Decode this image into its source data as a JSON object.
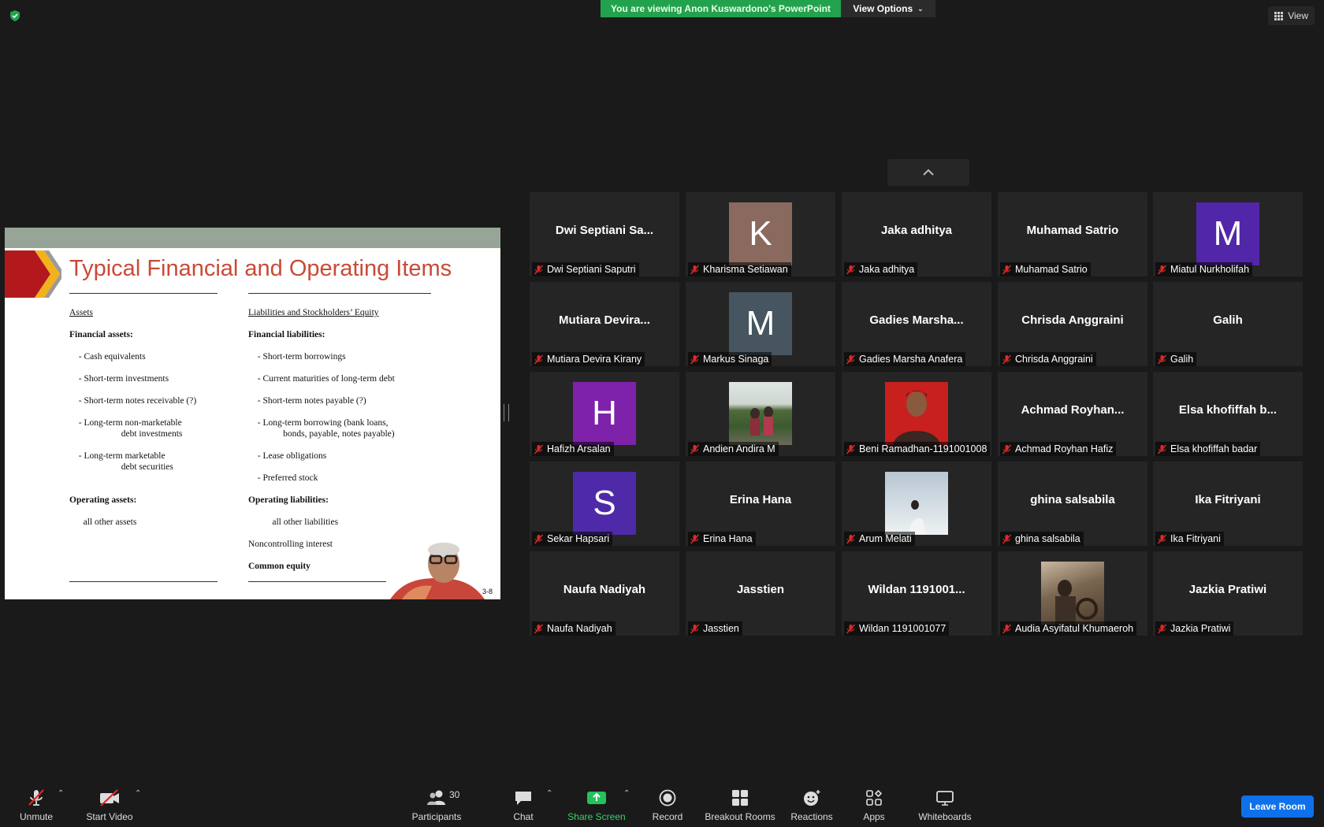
{
  "header": {
    "viewing_text": "You are viewing Anon Kuswardono's PowerPoint",
    "view_options_label": "View Options",
    "view_label": "View"
  },
  "slide": {
    "title": "Typical Financial and Operating Items",
    "page_number": "3-8",
    "left_column": [
      {
        "text": "Assets",
        "style": "u"
      },
      {
        "text": "Financial assets:",
        "style": "b"
      },
      {
        "text": "  - Cash equivalents",
        "style": ""
      },
      {
        "text": "  - Short-term investments",
        "style": ""
      },
      {
        "text": "  - Short-term notes receivable (?)",
        "style": ""
      },
      {
        "text": "  - Long-term non-marketable",
        "style": ""
      },
      {
        "text": "          debt investments",
        "style": ""
      },
      {
        "text": "  - Long-term marketable",
        "style": ""
      },
      {
        "text": "          debt securities",
        "style": ""
      },
      {
        "text": "Operating assets:",
        "style": "b"
      },
      {
        "text": "   all other assets",
        "style": ""
      }
    ],
    "right_column": [
      {
        "text": "Liabilities and Stockholders’ Equity",
        "style": "u"
      },
      {
        "text": "Financial liabilities:",
        "style": "b"
      },
      {
        "text": "  - Short-term borrowings",
        "style": ""
      },
      {
        "text": "  - Current maturities of long-term debt",
        "style": ""
      },
      {
        "text": "  - Short-term notes payable (?)",
        "style": ""
      },
      {
        "text": "  - Long-term borrowing (bank loans,",
        "style": ""
      },
      {
        "text": "       bonds, payable, notes payable)",
        "style": ""
      },
      {
        "text": "  - Lease obligations",
        "style": ""
      },
      {
        "text": "  - Preferred stock",
        "style": ""
      },
      {
        "text": "Operating liabilities:",
        "style": "b"
      },
      {
        "text": "     all other liabilities",
        "style": ""
      },
      {
        "text": "Noncontrolling interest",
        "style": ""
      },
      {
        "text": "Common equity",
        "style": "b"
      }
    ]
  },
  "participants": [
    {
      "display": "Dwi  Septiani  Sa...",
      "name": "Dwi Septiani Saputri",
      "avatar": null
    },
    {
      "display": "",
      "name": "Kharisma Setiawan",
      "avatar": {
        "letter": "K",
        "color": "#8a6a5e"
      }
    },
    {
      "display": "Jaka adhitya",
      "name": "Jaka adhitya",
      "avatar": null
    },
    {
      "display": "Muhamad Satrio",
      "name": "Muhamad Satrio",
      "avatar": null
    },
    {
      "display": "",
      "name": "Miatul Nurkholifah",
      "avatar": {
        "letter": "M",
        "color": "#5226a8"
      }
    },
    {
      "display": "Mutiara  Devira...",
      "name": "Mutiara Devira Kirany",
      "avatar": null
    },
    {
      "display": "",
      "name": "Markus Sinaga",
      "avatar": {
        "letter": "M",
        "color": "#46555f"
      }
    },
    {
      "display": "Gadies  Marsha...",
      "name": "Gadies Marsha Anafera",
      "avatar": null
    },
    {
      "display": "Chrisda Anggraini",
      "name": "Chrisda Anggraini",
      "avatar": null
    },
    {
      "display": "Galih",
      "name": "Galih",
      "avatar": null
    },
    {
      "display": "",
      "name": "Hafizh Arsalan",
      "avatar": {
        "letter": "H",
        "color": "#7e22aa"
      }
    },
    {
      "display": "",
      "name": "Andien Andira M",
      "avatar": {
        "photo": "outdoor"
      }
    },
    {
      "display": "",
      "name": "Beni Ramadhan-1191001008",
      "avatar": {
        "photo": "portrait-red"
      }
    },
    {
      "display": "Achmad  Royhan...",
      "name": "Achmad Royhan Hafiz",
      "avatar": null
    },
    {
      "display": "Elsa  khofiffah  b...",
      "name": "Elsa khofiffah badar",
      "avatar": null
    },
    {
      "display": "",
      "name": "Sekar Hapsari",
      "avatar": {
        "letter": "S",
        "color": "#4e2aa8"
      }
    },
    {
      "display": "Erina Hana",
      "name": "Erina Hana",
      "avatar": null
    },
    {
      "display": "",
      "name": "Arum Melati",
      "avatar": {
        "photo": "sky"
      }
    },
    {
      "display": "ghina salsabila",
      "name": "ghina salsabila",
      "avatar": null
    },
    {
      "display": "Ika Fitriyani",
      "name": "Ika Fitriyani",
      "avatar": null
    },
    {
      "display": "Naufa Nadiyah",
      "name": "Naufa Nadiyah",
      "avatar": null
    },
    {
      "display": "Jasstien",
      "name": "Jasstien",
      "avatar": null
    },
    {
      "display": "Wildan  1191001...",
      "name": "Wildan 1191001077",
      "avatar": null
    },
    {
      "display": "",
      "name": "Audia Asyifatul Khumaeroh",
      "avatar": {
        "photo": "sepia"
      }
    },
    {
      "display": "Jazkia Pratiwi",
      "name": "Jazkia Pratiwi",
      "avatar": null
    }
  ],
  "toolbar": {
    "unmute": "Unmute",
    "start_video": "Start Video",
    "participants": "Participants",
    "participants_count": "30",
    "chat": "Chat",
    "share_screen": "Share Screen",
    "record": "Record",
    "breakout_rooms": "Breakout Rooms",
    "reactions": "Reactions",
    "apps": "Apps",
    "whiteboards": "Whiteboards",
    "leave_room": "Leave Room"
  },
  "colors": {
    "background": "#1a1a1a",
    "banner_green": "#23a24d",
    "slide_title": "#c94a37",
    "leave_blue": "#0e71eb",
    "mute_red": "#e02828"
  }
}
